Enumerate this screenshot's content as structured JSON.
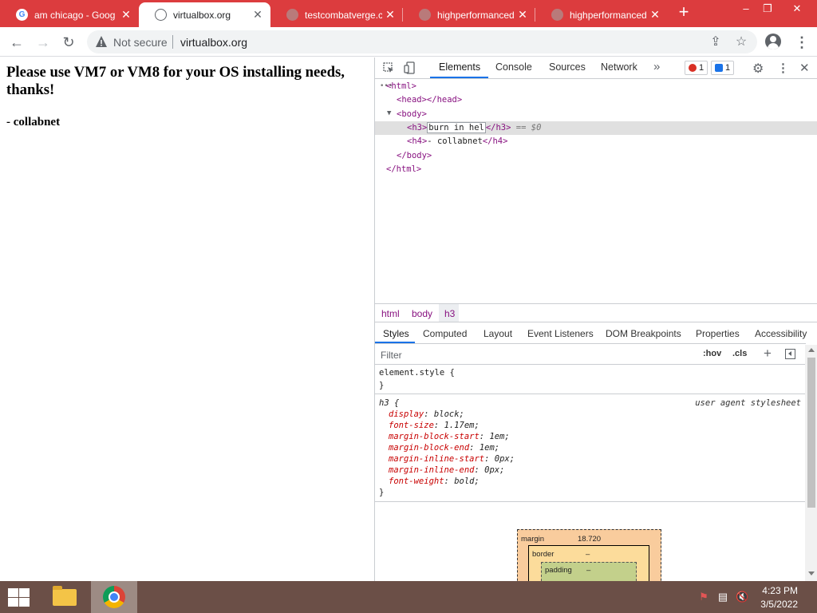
{
  "tabs": [
    {
      "title": "am chicago - Goog",
      "icon": "google-icon",
      "active": false
    },
    {
      "title": "virtualbox.org",
      "icon": "globe-icon",
      "active": true
    },
    {
      "title": "testcombatverge.c",
      "icon": "globe-icon",
      "active": false
    },
    {
      "title": "highperformanced",
      "icon": "globe-icon",
      "active": false
    },
    {
      "title": "highperformanced",
      "icon": "globe-icon",
      "active": false
    }
  ],
  "window_controls": {
    "minimize": "–",
    "restore": "❐",
    "close": "✕"
  },
  "address_bar": {
    "security_label": "Not secure",
    "url": "virtualbox.org"
  },
  "page": {
    "heading": "Please use VM7 or VM8 for your OS installing needs, thanks!",
    "signature": "- collabnet"
  },
  "devtools": {
    "tabs": [
      "Elements",
      "Console",
      "Sources",
      "Network"
    ],
    "more_tabs": "»",
    "error_count": "1",
    "message_count": "1",
    "dom": {
      "html_open": "<html>",
      "head": "<head></head>",
      "body_open": "<body>",
      "h3_open": "<h3>",
      "h3_edit_text": "burn in hel",
      "h3_close": "</h3>",
      "selected_marker": "== $0",
      "h4_open": "<h4>",
      "h4_text": "- collabnet",
      "h4_close": "</h4>",
      "body_close": "</body>",
      "html_close": "</html>",
      "ellipsis": "•••"
    },
    "breadcrumbs": [
      "html",
      "body",
      "h3"
    ],
    "styles_tabs": [
      "Styles",
      "Computed",
      "Layout",
      "Event Listeners",
      "DOM Breakpoints",
      "Properties",
      "Accessibility"
    ],
    "filter_placeholder": "Filter",
    "hov": ":hov",
    "cls": ".cls",
    "rules": {
      "element_style": "element.style {",
      "close_brace": "}",
      "h3_selector": "h3 {",
      "source": "user agent stylesheet",
      "declarations": [
        {
          "prop": "display",
          "value": "block;"
        },
        {
          "prop": "font-size",
          "value": "1.17em;"
        },
        {
          "prop": "margin-block-start",
          "value": "1em;"
        },
        {
          "prop": "margin-block-end",
          "value": "1em;"
        },
        {
          "prop": "margin-inline-start",
          "value": "0px;"
        },
        {
          "prop": "margin-inline-end",
          "value": "0px;"
        },
        {
          "prop": "font-weight",
          "value": "bold;"
        }
      ]
    },
    "box_model": {
      "margin_label": "margin",
      "margin_value": "18.720",
      "border_label": "border",
      "border_value": "–",
      "padding_label": "padding",
      "padding_value": "–"
    }
  },
  "taskbar": {
    "time": "4:23 PM",
    "date": "3/5/2022"
  },
  "colors": {
    "tabstrip": "#dc3c3e",
    "taskbar": "#6b4f47",
    "devtools_accent": "#1a73e8",
    "tag_color": "#881280"
  }
}
